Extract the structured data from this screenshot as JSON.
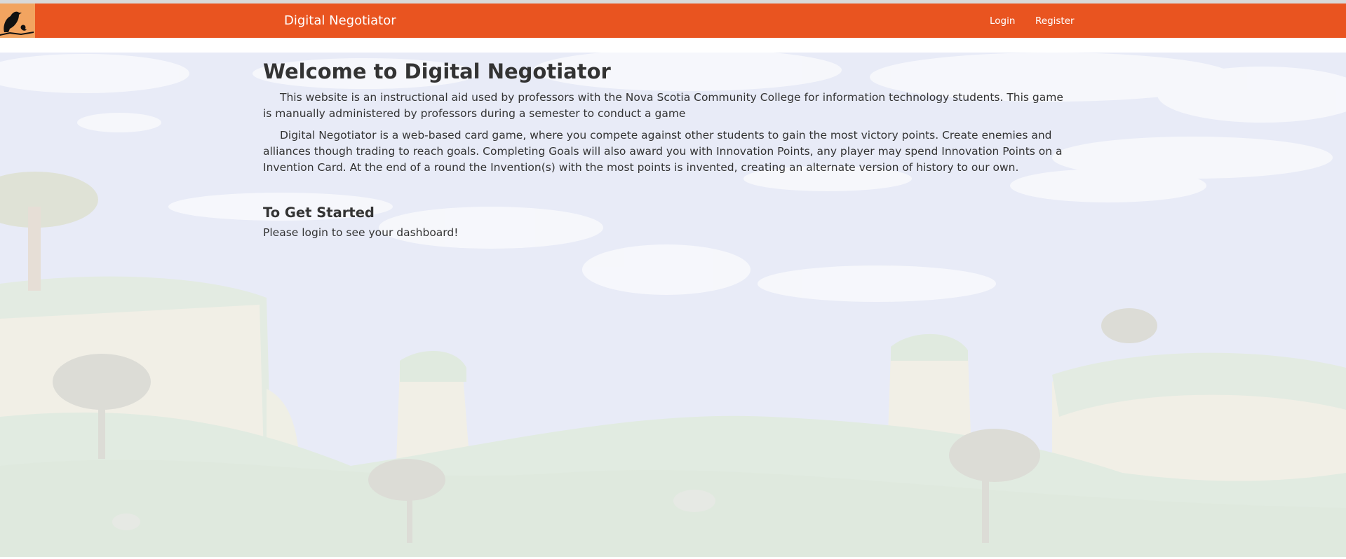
{
  "navbar": {
    "brand": "Digital Negotiator",
    "logo_icon": "bird-on-branch-icon",
    "links": [
      {
        "label": "Login"
      },
      {
        "label": "Register"
      }
    ],
    "color": "#e95420"
  },
  "main": {
    "title": "Welcome to Digital Negotiator",
    "paragraphs": [
      "This website is an instructional aid used by professors with the Nova Scotia Community College for information technology students. This game is manually administered by professors during a semester to conduct a game",
      "Digital Negotiator is a web-based card game, where you compete against other students to gain the most victory points. Create enemies and alliances though trading to reach goals. Completing Goals will also award you with Innovation Points, any player may spend Innovation Points on a Invention Card. At the end of a round the Invention(s) with the most points is invented, creating an alternate version of history to our own."
    ],
    "section_title": "To Get Started",
    "section_text": "Please login to see your dashboard!"
  },
  "background": {
    "description_icon": "landscape-background-image",
    "sky_color": "#e9ecf6"
  }
}
